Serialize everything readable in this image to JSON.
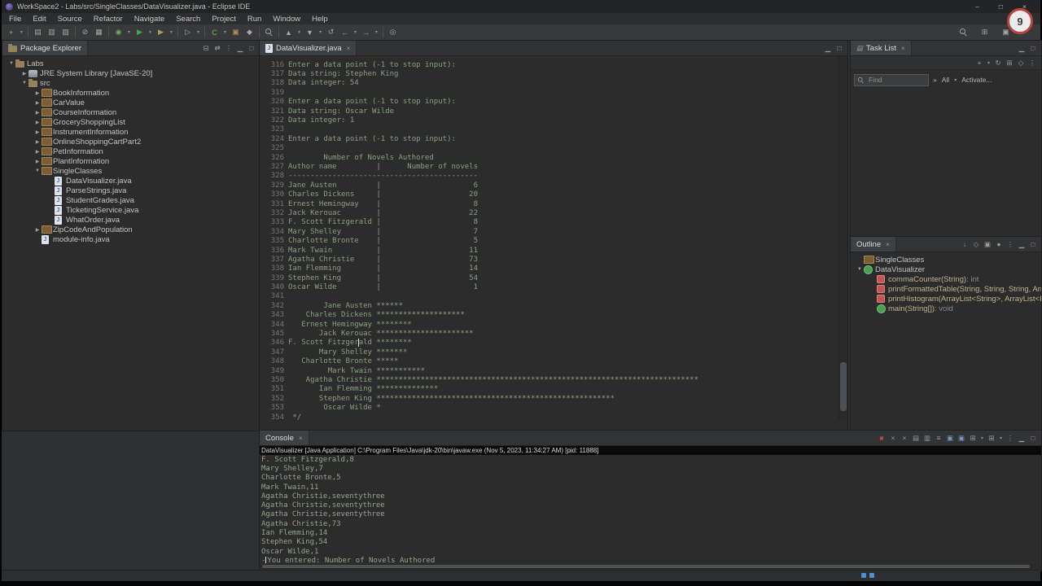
{
  "window": {
    "title": "WorkSpace2 - Labs/src/SingleClasses/DataVisualizer.java - Eclipse IDE",
    "controls": [
      "–",
      "□",
      "×"
    ]
  },
  "overlay": {
    "badge": "9"
  },
  "menu": [
    "File",
    "Edit",
    "Source",
    "Refactor",
    "Navigate",
    "Search",
    "Project",
    "Run",
    "Window",
    "Help"
  ],
  "toolbar": {
    "left": [
      {
        "name": "new-wizard-icon",
        "g": "+"
      },
      {
        "name": "new-dropdown-icon",
        "g": "▾",
        "dd": 1
      },
      {
        "sep": 1
      },
      {
        "name": "save-icon",
        "g": "▤"
      },
      {
        "name": "save-all-icon",
        "g": "▥"
      },
      {
        "name": "print-icon",
        "g": "▨"
      },
      {
        "sep": 1
      },
      {
        "name": "skip-breakpoints-icon",
        "g": "⊘"
      },
      {
        "name": "console-view-icon",
        "g": "▦"
      },
      {
        "sep": 1
      },
      {
        "name": "debug-icon",
        "g": "◉",
        "c": "#79a65b"
      },
      {
        "name": "debug-dropdown-icon",
        "g": "▾",
        "dd": 1
      },
      {
        "name": "run-icon",
        "g": "▶",
        "c": "#49a84d"
      },
      {
        "name": "run-dropdown-icon",
        "g": "▾",
        "dd": 1
      },
      {
        "name": "coverage-icon",
        "g": "▶",
        "c": "#a7a05a"
      },
      {
        "name": "coverage-dropdown-icon",
        "g": "▾",
        "dd": 1
      },
      {
        "sep": 1
      },
      {
        "name": "external-tools-icon",
        "g": "▷"
      },
      {
        "name": "external-tools-dropdown-icon",
        "g": "▾",
        "dd": 1
      },
      {
        "sep": 1
      },
      {
        "name": "new-class-icon",
        "g": "C",
        "c": "#6abf69"
      },
      {
        "name": "new-class-dropdown-icon",
        "g": "▾",
        "dd": 1
      },
      {
        "name": "new-package-icon",
        "g": "▣",
        "c": "#b08d57"
      },
      {
        "name": "new-jar-icon",
        "g": "◆"
      },
      {
        "sep": 1
      },
      {
        "name": "search-icon",
        "g": "mag"
      },
      {
        "sep": 1
      },
      {
        "name": "prev-annotation-icon",
        "g": "▲"
      },
      {
        "name": "prev-annotation-dropdown-icon",
        "g": "▾",
        "dd": 1
      },
      {
        "name": "next-annotation-icon",
        "g": "▼"
      },
      {
        "name": "next-annotation-dropdown-icon",
        "g": "▾",
        "dd": 1
      },
      {
        "name": "last-edit-location-icon",
        "g": "↺"
      },
      {
        "name": "back-icon",
        "g": "←"
      },
      {
        "name": "back-dropdown-icon",
        "g": "▾",
        "dd": 1
      },
      {
        "name": "forward-icon",
        "g": "→"
      },
      {
        "name": "forward-dropdown-icon",
        "g": "▾",
        "dd": 1
      },
      {
        "sep": 1
      },
      {
        "name": "screenshot-icon",
        "g": "◎"
      }
    ],
    "right": [
      {
        "name": "quick-search-icon",
        "g": "mag"
      },
      {
        "name": "open-perspective-icon",
        "g": "⊞"
      },
      {
        "name": "java-perspective-icon",
        "g": "▣"
      }
    ]
  },
  "package_explorer": {
    "title": "Package Explorer",
    "header_icons": [
      {
        "name": "collapse-all-icon",
        "g": "⊟"
      },
      {
        "name": "link-editor-icon",
        "g": "⇄"
      },
      {
        "name": "view-menu-icon",
        "g": "⋮"
      },
      {
        "name": "minimize-icon",
        "g": "▁"
      },
      {
        "name": "maximize-icon",
        "g": "□"
      }
    ],
    "items": [
      {
        "label": "Labs",
        "indent": 0,
        "arrow": "down",
        "icon": "project"
      },
      {
        "label": "JRE System Library [JavaSE-20]",
        "indent": 1,
        "arrow": "right",
        "icon": "library"
      },
      {
        "label": "src",
        "indent": 1,
        "arrow": "down",
        "icon": "src-folder"
      },
      {
        "label": "BookInformation",
        "indent": 2,
        "arrow": "right",
        "icon": "package"
      },
      {
        "label": "CarValue",
        "indent": 2,
        "arrow": "right",
        "icon": "package"
      },
      {
        "label": "CourseInformation",
        "indent": 2,
        "arrow": "right",
        "icon": "package"
      },
      {
        "label": "GroceryShoppingList",
        "indent": 2,
        "arrow": "right",
        "icon": "package"
      },
      {
        "label": "InstrumentInformation",
        "indent": 2,
        "arrow": "right",
        "icon": "package"
      },
      {
        "label": "OnlineShoppingCartPart2",
        "indent": 2,
        "arrow": "right",
        "icon": "package"
      },
      {
        "label": "PetInformation",
        "indent": 2,
        "arrow": "right",
        "icon": "package"
      },
      {
        "label": "PlantInformation",
        "indent": 2,
        "arrow": "right",
        "icon": "package"
      },
      {
        "label": "SingleClasses",
        "indent": 2,
        "arrow": "down",
        "icon": "package"
      },
      {
        "label": "DataVisualizer.java",
        "indent": 3,
        "arrow": "",
        "icon": "jfile"
      },
      {
        "label": "ParseStrings.java",
        "indent": 3,
        "arrow": "",
        "icon": "jfile"
      },
      {
        "label": "StudentGrades.java",
        "indent": 3,
        "arrow": "",
        "icon": "jfile"
      },
      {
        "label": "TicketingService.java",
        "indent": 3,
        "arrow": "",
        "icon": "jfile"
      },
      {
        "label": "WhatOrder.java",
        "indent": 3,
        "arrow": "",
        "icon": "jfile"
      },
      {
        "label": "ZipCodeAndPopulation",
        "indent": 2,
        "arrow": "right",
        "icon": "package"
      },
      {
        "label": "module-info.java",
        "indent": 2,
        "arrow": "",
        "icon": "jfile"
      }
    ]
  },
  "editor": {
    "tab_label": "DataVisualizer.java",
    "header_icons": [
      {
        "name": "minimize-icon",
        "g": "▁"
      },
      {
        "name": "maximize-icon",
        "g": "□"
      }
    ],
    "lines": [
      {
        "n": 316,
        "t": "Enter a data point (-1 to stop input):"
      },
      {
        "n": 317,
        "t": "Data string: Stephen King"
      },
      {
        "n": 318,
        "t": "Data integer: 54"
      },
      {
        "n": 319,
        "t": ""
      },
      {
        "n": 320,
        "t": "Enter a data point (-1 to stop input):"
      },
      {
        "n": 321,
        "t": "Data string: Oscar Wilde"
      },
      {
        "n": 322,
        "t": "Data integer: 1"
      },
      {
        "n": 323,
        "t": ""
      },
      {
        "n": 324,
        "t": "Enter a data point (-1 to stop input):"
      },
      {
        "n": 325,
        "t": ""
      },
      {
        "n": 326,
        "t": "        Number of Novels Authored"
      },
      {
        "n": 327,
        "t": "Author name         |      Number of novels"
      },
      {
        "n": 328,
        "t": "-------------------------------------------"
      },
      {
        "n": 329,
        "t": "Jane Austen         |                     6"
      },
      {
        "n": 330,
        "t": "Charles Dickens     |                    20"
      },
      {
        "n": 331,
        "t": "Ernest Hemingway    |                     8"
      },
      {
        "n": 332,
        "t": "Jack Kerouac        |                    22"
      },
      {
        "n": 333,
        "t": "F. Scott Fitzgerald |                     8"
      },
      {
        "n": 334,
        "t": "Mary Shelley        |                     7"
      },
      {
        "n": 335,
        "t": "Charlotte Bronte    |                     5"
      },
      {
        "n": 336,
        "t": "Mark Twain          |                    11"
      },
      {
        "n": 337,
        "t": "Agatha Christie     |                    73"
      },
      {
        "n": 338,
        "t": "Ian Flemming        |                    14"
      },
      {
        "n": 339,
        "t": "Stephen King        |                    54"
      },
      {
        "n": 340,
        "t": "Oscar Wilde         |                     1"
      },
      {
        "n": 341,
        "t": ""
      },
      {
        "n": 342,
        "t": "        Jane Austen ******"
      },
      {
        "n": 343,
        "t": "    Charles Dickens ********************"
      },
      {
        "n": 344,
        "t": "   Ernest Hemingway ********"
      },
      {
        "n": 345,
        "t": "       Jack Kerouac **********************"
      },
      {
        "n": 346,
        "t": "F. Scott Fitzgerald ********"
      },
      {
        "n": 347,
        "t": "       Mary Shelley *******"
      },
      {
        "n": 348,
        "t": "   Charlotte Bronte *****"
      },
      {
        "n": 349,
        "t": "         Mark Twain ***********"
      },
      {
        "n": 350,
        "t": "    Agatha Christie *************************************************************************"
      },
      {
        "n": 351,
        "t": "       Ian Flemming **************"
      },
      {
        "n": 352,
        "t": "       Stephen King ******************************************************"
      },
      {
        "n": 353,
        "t": "        Oscar Wilde *"
      },
      {
        "n": 354,
        "t": " */"
      }
    ]
  },
  "task_list": {
    "title": "Task List",
    "header_icons": [
      {
        "name": "minimize-icon",
        "g": "▁"
      },
      {
        "name": "maximize-icon",
        "g": "□"
      }
    ],
    "toolbar_icons": [
      {
        "name": "new-task-icon",
        "g": "+"
      },
      {
        "name": "new-task-dropdown-icon",
        "g": "▾",
        "dd": 1
      },
      {
        "name": "synchronize-icon",
        "g": "↻"
      },
      {
        "name": "categorize-icon",
        "g": "⊞"
      },
      {
        "name": "filter-icon",
        "g": "◇"
      },
      {
        "name": "view-menu-icon",
        "g": "⋮"
      }
    ],
    "find_placeholder": "Find",
    "chevron": "»",
    "all_label": "All",
    "all_dropdown": "▾",
    "activate_label": "Activate..."
  },
  "outline": {
    "title": "Outline",
    "header_icons": [
      {
        "name": "sort-icon",
        "g": "↓"
      },
      {
        "name": "hide-fields-icon",
        "g": "◇"
      },
      {
        "name": "hide-static-icon",
        "g": "▣"
      },
      {
        "name": "hide-non-public-icon",
        "g": "●"
      },
      {
        "name": "view-menu-icon",
        "g": "⋮"
      },
      {
        "name": "minimize-icon",
        "g": "▁"
      },
      {
        "name": "maximize-icon",
        "g": "□"
      }
    ],
    "items": [
      {
        "label": "SingleClasses",
        "suffix": "",
        "indent": 0,
        "arrow": "",
        "icon": "package"
      },
      {
        "label": "DataVisualizer",
        "suffix": "",
        "indent": 0,
        "arrow": "down",
        "icon": "class"
      },
      {
        "label": "commaCounter(String)",
        "suffix": " : int",
        "indent": 1,
        "arrow": "",
        "icon": "method-red"
      },
      {
        "label": "printFormattedTable(String, String, String, ArrayList<String>,",
        "suffix": "",
        "indent": 1,
        "arrow": "",
        "icon": "method-red"
      },
      {
        "label": "printHistogram(ArrayList<String>, ArrayList<Integer>)",
        "suffix": " : void",
        "indent": 1,
        "arrow": "",
        "icon": "method-red"
      },
      {
        "label": "main(String[])",
        "suffix": " : void",
        "indent": 1,
        "arrow": "",
        "icon": "method-green"
      }
    ]
  },
  "console": {
    "title": "Console",
    "header_icons": [
      {
        "name": "terminate-icon",
        "g": "■",
        "c": "#c0453e"
      },
      {
        "name": "remove-launch-icon",
        "g": "×"
      },
      {
        "name": "remove-all-launches-icon",
        "g": "×"
      },
      {
        "name": "clear-console-icon",
        "g": "▤"
      },
      {
        "name": "scroll-lock-icon",
        "g": "▥"
      },
      {
        "name": "word-wrap-icon",
        "g": "≡"
      },
      {
        "name": "show-stdout-icon",
        "g": "▣",
        "c": "#7596c8"
      },
      {
        "name": "show-stderr-icon",
        "g": "▣",
        "c": "#7596c8"
      },
      {
        "name": "pin-console-icon",
        "g": "⊞"
      },
      {
        "name": "display-console-dropdown-icon",
        "g": "▾",
        "dd": 1
      },
      {
        "name": "open-console-icon",
        "g": "⊞"
      },
      {
        "name": "open-console-dropdown-icon",
        "g": "▾",
        "dd": 1
      },
      {
        "name": "view-menu-icon",
        "g": "⋮"
      },
      {
        "name": "minimize-icon",
        "g": "▁"
      },
      {
        "name": "maximize-icon",
        "g": "□"
      }
    ],
    "description": "DataVisualizer [Java Application] C:\\Program Files\\Java\\jdk-20\\bin\\javaw.exe (Nov 5, 2023, 11:34:27 AM) [pid: 11888]",
    "lines": [
      "F. Scott Fitzgerald,8",
      "Mary Shelley,7",
      "Charlotte Bronte,5",
      "Mark Twain,11",
      "Agatha Christie,seventythree",
      "Agatha Christie,seventythree",
      "Agatha Christie,seventythree",
      "Agatha Christie,73",
      "Ian Flemming,14",
      "Stephen King,54",
      "Oscar Wilde,1"
    ],
    "input_line": {
      "prefix": "-",
      "text": "You entered: Number of Novels Authored"
    }
  }
}
